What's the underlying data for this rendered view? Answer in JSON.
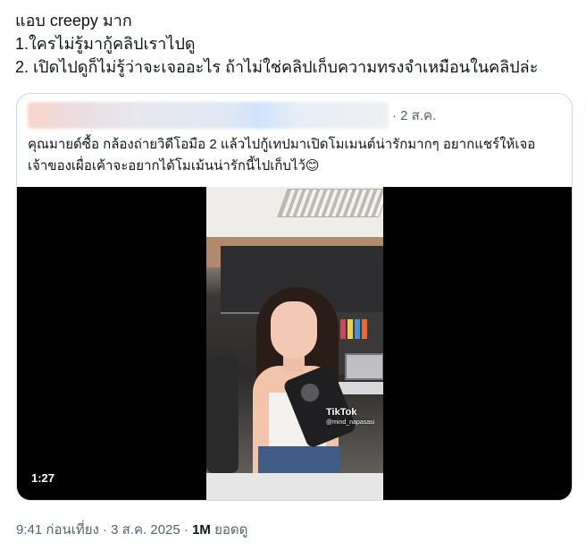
{
  "tweet": {
    "lines": [
      "แอบ creepy มาก",
      "1.ใครไม่รู้มากู้คลิปเราไปดู",
      "2. เปิดไปดูก็ไม่รู้ว่าจะเจออะไร ถ้าไม่ใช่คลิปเก็บความทรงจำเหมือนในคลิปล่ะ"
    ]
  },
  "quote": {
    "date": "· 2 ส.ค.",
    "text_lines": [
      "คุณมายด์ซื้อ กล้องถ่ายวิดีโอมือ 2 แล้วไปกู้เทปมาเปิดโมเมนต์น่ารักมากๆ อยากแชร์ให้เจอ",
      "เจ้าของเผื่อเค้าจะอยากได้โมเม้นน่ารักนี้ไปเก็บไว้😊"
    ],
    "video": {
      "duration": "1:27",
      "watermark": "TikTok",
      "watermark_handle": "@mind_napasasi"
    }
  },
  "meta": {
    "time": "9:41 ก่อนเที่ยง · 3 ส.ค. 2025 · ",
    "views_count": "1M",
    "views_label": " ยอดดู"
  }
}
